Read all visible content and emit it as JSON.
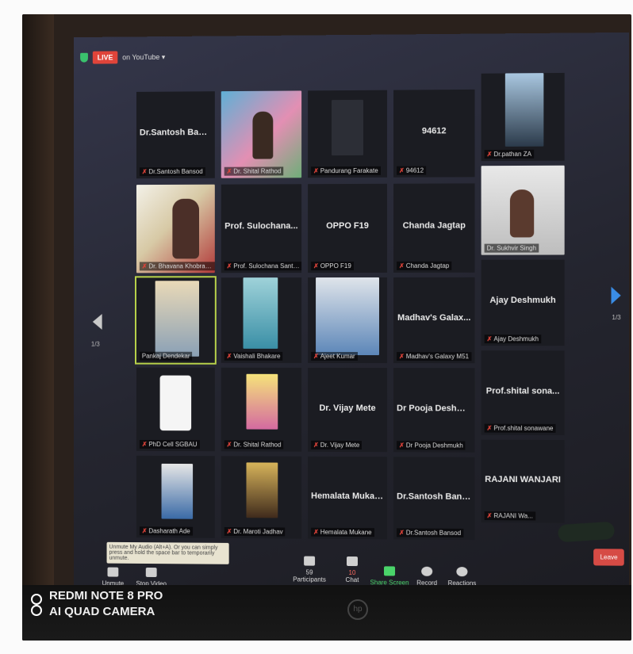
{
  "top_bar": {
    "live": "LIVE",
    "stream": "on YouTube ▾"
  },
  "tiles": [
    {
      "id": "t1",
      "center": "Dr.Santosh Bans...",
      "tag": "Dr.Santosh Bansod",
      "muted": true
    },
    {
      "id": "t2",
      "center": "",
      "tag": "Dr. Shital Rathod",
      "muted": true
    },
    {
      "id": "t3",
      "center": "",
      "tag": "Pandurang Farakate",
      "muted": true
    },
    {
      "id": "t4",
      "center": "94612",
      "tag": "94612",
      "muted": true
    },
    {
      "id": "t5",
      "center": "",
      "tag": "Dr.pathan ZA",
      "muted": true
    },
    {
      "id": "t6",
      "center": "",
      "tag": "Dr. Bhavana Khobragade",
      "muted": true
    },
    {
      "id": "t7",
      "center": "Prof. Sulochana...",
      "tag": "Prof. Sulochana Santoshrao L...",
      "muted": true
    },
    {
      "id": "t8",
      "center": "OPPO F19",
      "tag": "OPPO F19",
      "muted": true
    },
    {
      "id": "t9",
      "center": "Chanda Jagtap",
      "tag": "Chanda Jagtap",
      "muted": true
    },
    {
      "id": "t10",
      "center": "",
      "tag": "Dr. Sukhvir Singh",
      "muted": false
    },
    {
      "id": "t11",
      "center": "",
      "tag": "Pankaj Dendekar",
      "muted": false
    },
    {
      "id": "t12",
      "center": "",
      "tag": "Vaishali Bhakare",
      "muted": true
    },
    {
      "id": "t13",
      "center": "",
      "tag": "Ajeet Kumar",
      "muted": true
    },
    {
      "id": "t14",
      "center": "Madhav's Galax...",
      "tag": "Madhav's Galaxy M51",
      "muted": true
    },
    {
      "id": "t15",
      "center": "Ajay Deshmukh",
      "tag": "Ajay Deshmukh",
      "muted": true
    },
    {
      "id": "t16",
      "center": "",
      "tag": "PhD Cell SGBAU",
      "muted": true
    },
    {
      "id": "t17",
      "center": "",
      "tag": "Dr. Shital Rathod",
      "muted": true
    },
    {
      "id": "t18",
      "center": "Dr. Vijay Mete",
      "tag": "Dr. Vijay Mete",
      "muted": true
    },
    {
      "id": "t19",
      "center": "Dr Pooja Deshm...",
      "tag": "Dr Pooja Deshmukh",
      "muted": true
    },
    {
      "id": "t20",
      "center": "Prof.shital sona...",
      "tag": "Prof.shital sonawane",
      "muted": true
    },
    {
      "id": "t21",
      "center": "",
      "tag": "Dasharath Ade",
      "muted": true
    },
    {
      "id": "t22",
      "center": "",
      "tag": "Dr. Maroti Jadhav",
      "muted": true
    },
    {
      "id": "t23",
      "center": "Hemalata Mukane",
      "tag": "Hemalata Mukane",
      "muted": true
    },
    {
      "id": "t24",
      "center": "Dr.Santosh Bans...",
      "tag": "Dr.Santosh Bansod",
      "muted": true
    },
    {
      "id": "t25",
      "center": "RAJANI WANJARI",
      "tag": "RAJANI Wa...",
      "muted": true
    }
  ],
  "nav": {
    "left_page": "1/3",
    "right_page": "1/3"
  },
  "toolbar": {
    "tooltip": "Unmute My Audio (Alt+A). Or you can simply press and hold the space bar to temporarily unmute.",
    "unmute": "Unmute",
    "stop_video": "Stop Video",
    "participants": "Participants",
    "participants_count": "59",
    "chat": "Chat",
    "chat_badge": "10",
    "share_screen": "Share Screen",
    "record": "Record",
    "reactions": "Reactions",
    "leave": "Leave"
  },
  "watermark": {
    "line1": "REDMI NOTE 8 PRO",
    "line2": "AI QUAD CAMERA"
  },
  "monitor_brand": "hp"
}
